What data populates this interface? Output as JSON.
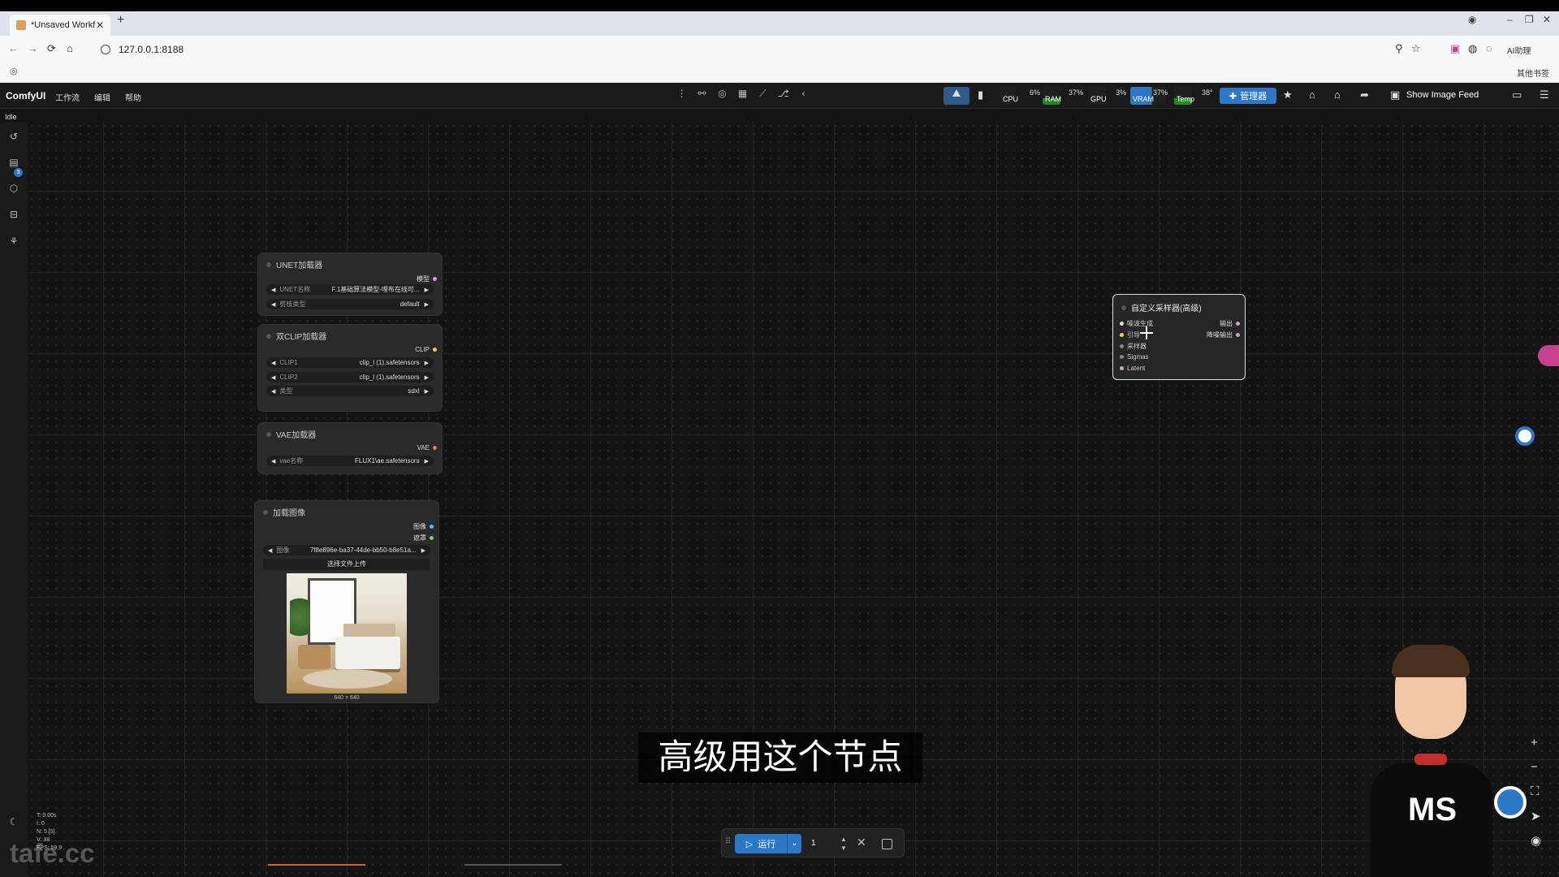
{
  "browser": {
    "tab_title": "*Unsaved Workf",
    "url": "127.0.0.1:8188",
    "other_bookmarks": "其他书签",
    "ext_label": "AI助理"
  },
  "menu": {
    "logo": "ComfyUI",
    "items": [
      "工作流",
      "编辑",
      "帮助"
    ],
    "status": "Idle",
    "manager": "管理器",
    "show_image_feed": "Show Image Feed"
  },
  "monitor": {
    "cpu_label": "CPU",
    "cpu_pct": "6%",
    "ram_label": "RAM",
    "ram_pct": "37%",
    "gpu_label": "GPU",
    "gpu_pct": "3%",
    "vram_label": "VRAM",
    "vram_pct": "37%",
    "temp_label": "Temp",
    "temp_val": "38°"
  },
  "sidebar": {
    "badge_count": "3"
  },
  "nodes": {
    "unet": {
      "title": "UNET加载器",
      "output": "模型",
      "w1_label": "UNET名称",
      "w1_value": "F.1基础算法模型-哩布在线可...",
      "w2_label": "剪枝类型",
      "w2_value": "default"
    },
    "dualclip": {
      "title": "双CLIP加载器",
      "output": "CLIP",
      "w1_label": "CLIP1",
      "w1_value": "clip_l (1).safetensors",
      "w2_label": "CLIP2",
      "w2_value": "clip_l (1).safetensors",
      "w3_label": "类型",
      "w3_value": "sdxl"
    },
    "vae": {
      "title": "VAE加载器",
      "output": "VAE",
      "w1_label": "vae名称",
      "w1_value": "FLUX1\\ae.safetensors"
    },
    "loadimage": {
      "title": "加载图像",
      "out1": "图像",
      "out2": "遮罩",
      "w1_label": "图像",
      "w1_value": "7f8e896e-ba37-44de-bb50-b8e51a...",
      "upload": "选择文件上传",
      "size": "640 × 640"
    },
    "sampler": {
      "title": "自定义采样器(高级)",
      "inputs": [
        "噪波生成",
        "引导",
        "采样器",
        "Sigmas",
        "Latent"
      ],
      "outputs": [
        "输出",
        "降噪输出"
      ]
    }
  },
  "subtitle": "高级用这个节点",
  "runbar": {
    "run_label": "运行",
    "count": "1"
  },
  "stats": [
    "T: 0.00s",
    "I: 0",
    "N: 5 [5]",
    "V: 38",
    "FPS: 59.9"
  ],
  "watermark": "tafe.cc",
  "avatar_text": "MS"
}
